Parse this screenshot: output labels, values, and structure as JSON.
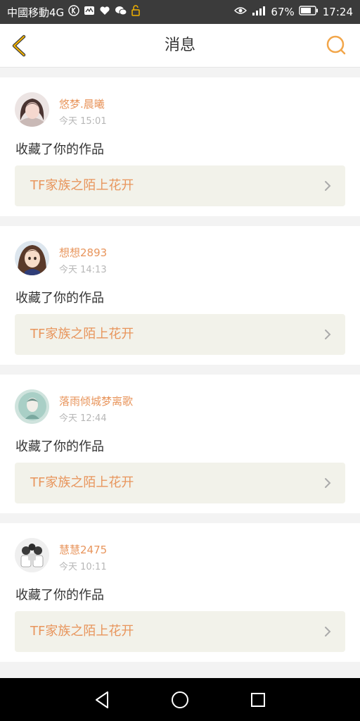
{
  "status_bar": {
    "carrier": "中國移動4G",
    "battery_percent": "67%",
    "time": "17:24",
    "icons_left": [
      "k-icon",
      "activity-icon",
      "heart-icon",
      "wechat-icon",
      "unlock-icon"
    ],
    "icons_right": [
      "eye-icon",
      "signal-icon",
      "battery-icon"
    ]
  },
  "header": {
    "title": "消息",
    "back_icon": "chevron-left-icon",
    "search_icon": "search-icon",
    "accent_color": "#f2b100"
  },
  "messages": [
    {
      "username": "悠梦.晨曦",
      "time": "今天 15:01",
      "action": "收藏了你的作品",
      "work_title": "TF家族之陌上花开",
      "avatar": "avatar-photo-1"
    },
    {
      "username": "想想2893",
      "time": "今天 14:13",
      "action": "收藏了你的作品",
      "work_title": "TF家族之陌上花开",
      "avatar": "avatar-photo-2"
    },
    {
      "username": "落雨倾城梦离歌",
      "time": "今天 12:44",
      "action": "收藏了你的作品",
      "work_title": "TF家族之陌上花开",
      "avatar": "avatar-photo-3"
    },
    {
      "username": "慧慧2475",
      "time": "今天 10:11",
      "action": "收藏了你的作品",
      "work_title": "TF家族之陌上花开",
      "avatar": "avatar-photo-4"
    }
  ],
  "nav_bar": {
    "buttons": [
      "back-triangle-icon",
      "home-circle-icon",
      "recents-square-icon"
    ]
  },
  "colors": {
    "username": "#e8955c",
    "work_title": "#e8955c",
    "timestamp": "#b7b7b7",
    "link_bg": "#f2f2ea"
  }
}
